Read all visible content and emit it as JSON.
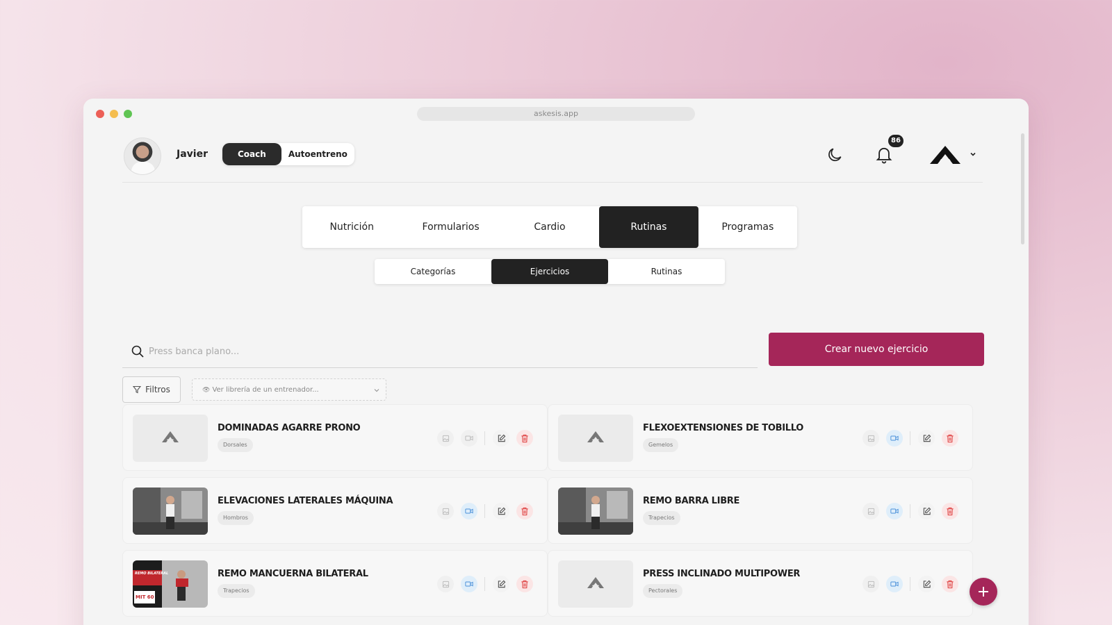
{
  "browser": {
    "url": "askesis.app"
  },
  "header": {
    "user_name": "Javier",
    "mode_options": [
      "Coach",
      "Autoentreno"
    ],
    "active_mode": "Coach",
    "notifications_count": "86"
  },
  "main_tabs": [
    {
      "label": "Nutrición",
      "active": false
    },
    {
      "label": "Formularios",
      "active": false
    },
    {
      "label": "Cardio",
      "active": false
    },
    {
      "label": "Rutinas",
      "active": true
    },
    {
      "label": "Programas",
      "active": false
    }
  ],
  "sub_tabs": [
    {
      "label": "Categorías",
      "active": false
    },
    {
      "label": "Ejercicios",
      "active": true
    },
    {
      "label": "Rutinas",
      "active": false
    }
  ],
  "search": {
    "placeholder": "Press banca plano...",
    "value": ""
  },
  "create_button": "Crear nuevo ejercicio",
  "filters_button": "Filtros",
  "trainer_select": {
    "placeholder": "Ver librería de un entrenador..."
  },
  "exercises": [
    {
      "name": "DOMINADAS AGARRE PRONO",
      "tag": "Dorsales",
      "thumb": "logo",
      "has_video": false
    },
    {
      "name": "FLEXOEXTENSIONES DE TOBILLO",
      "tag": "Gemelos",
      "thumb": "logo",
      "has_video": true
    },
    {
      "name": "ELEVACIONES LATERALES MÁQUINA",
      "tag": "Hombros",
      "thumb": "photo",
      "has_video": true
    },
    {
      "name": "REMO BARRA LIBRE",
      "tag": "Trapecios",
      "thumb": "photo",
      "has_video": true
    },
    {
      "name": "REMO MANCUERNA BILATERAL",
      "tag": "Trapecios",
      "thumb": "photo-red",
      "thumb_text": [
        "REMO BILATERAL",
        "MIT 60"
      ],
      "has_video": true
    },
    {
      "name": "PRESS INCLINADO MULTIPOWER",
      "tag": "Pectorales",
      "thumb": "logo",
      "has_video": true
    }
  ],
  "colors": {
    "accent": "#a52659",
    "dark": "#222222",
    "video_active": "#4a90d9",
    "delete": "#e04848"
  }
}
